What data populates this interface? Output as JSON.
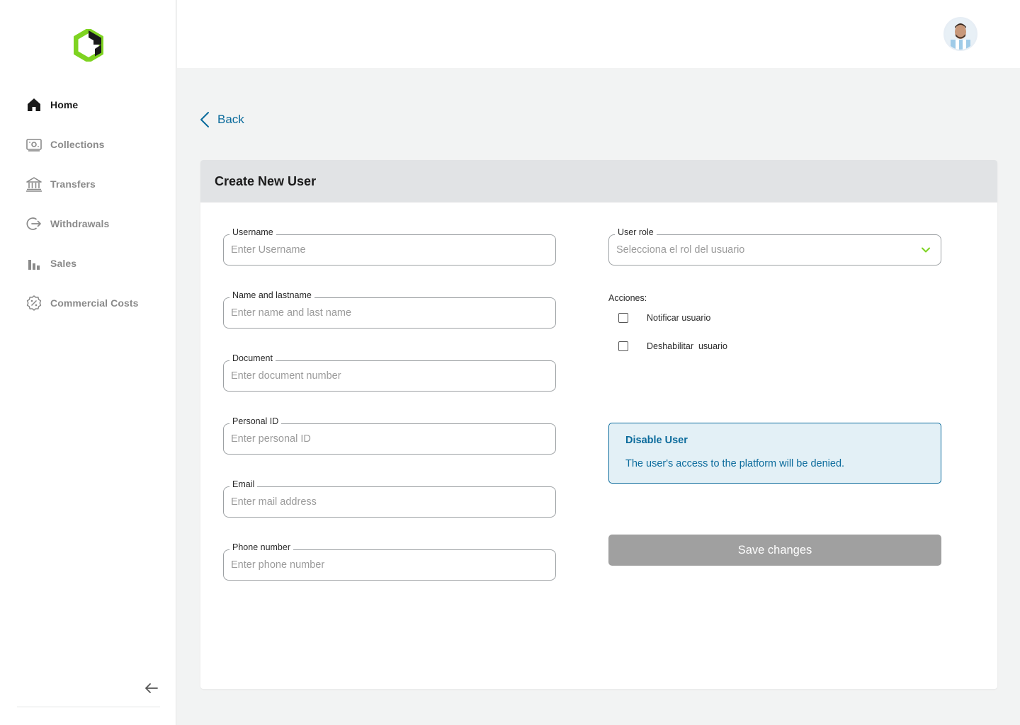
{
  "sidebar": {
    "items": [
      {
        "label": "Home",
        "icon": "home-icon"
      },
      {
        "label": "Collections",
        "icon": "collections-icon"
      },
      {
        "label": "Transfers",
        "icon": "bank-icon"
      },
      {
        "label": "Withdrawals",
        "icon": "withdraw-icon"
      },
      {
        "label": "Sales",
        "icon": "bar-chart-icon"
      },
      {
        "label": "Commercial Costs",
        "icon": "percent-badge-icon"
      }
    ],
    "collapse_icon": "arrow-left-icon"
  },
  "back": {
    "label": "Back"
  },
  "card": {
    "title": "Create New User"
  },
  "form": {
    "username": {
      "label": "Username",
      "placeholder": "Enter Username"
    },
    "name": {
      "label": "Name and lastname",
      "placeholder": "Enter name and last name"
    },
    "document": {
      "label": "Document",
      "placeholder": "Enter document number"
    },
    "personal_id": {
      "label": "Personal ID",
      "placeholder": "Enter personal ID"
    },
    "email": {
      "label": "Email",
      "placeholder": "Enter mail address"
    },
    "phone": {
      "label": "Phone number",
      "placeholder": "Enter phone number"
    },
    "role": {
      "label": "User role",
      "placeholder": "Selecciona el rol del usuario"
    }
  },
  "actions": {
    "label": "Acciones:",
    "notify": "Notificar usuario",
    "disable": "Deshabilitar  usuario"
  },
  "alert": {
    "title": "Disable User",
    "description": "The user's access to the platform will be denied."
  },
  "save_button": "Save changes",
  "colors": {
    "accent": "#0b6b9c",
    "brand_green": "#7ed321",
    "disabled_button": "#a0a0a0",
    "card_header": "#e1e3e5"
  }
}
